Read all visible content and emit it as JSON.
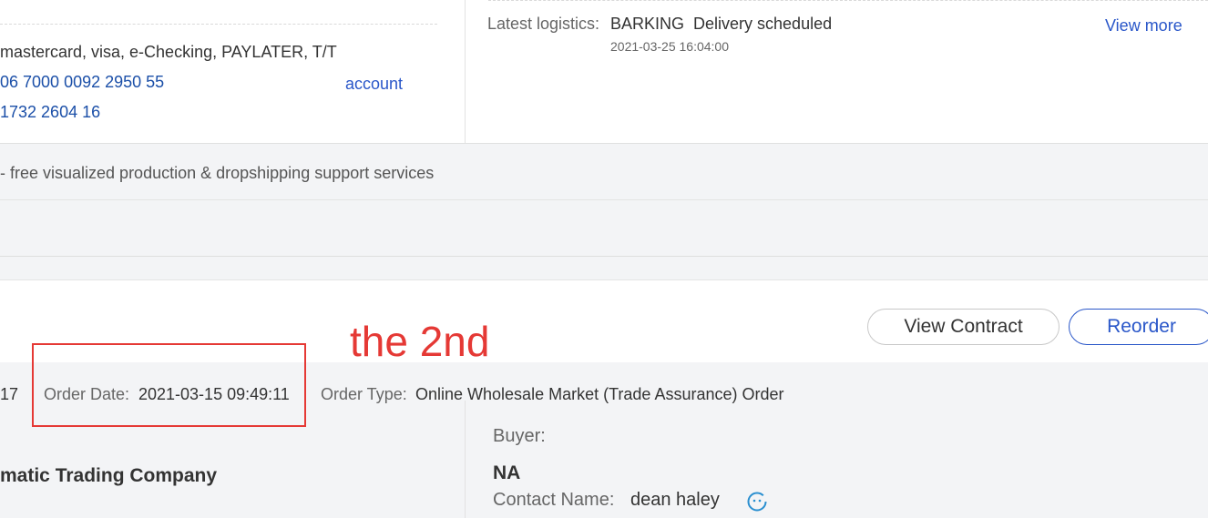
{
  "payment": {
    "methods": "mastercard, visa, e-Checking, PAYLATER, T/T",
    "account_number_1": "06 7000 0092 2950 55",
    "account_number_2": "1732 2604 16",
    "account_link": "account"
  },
  "logistics": {
    "label": "Latest logistics:",
    "status": "BARKING  Delivery scheduled",
    "timestamp": "2021-03-25 16:04:00",
    "view_more": "View more"
  },
  "promo": {
    "text": "- free visualized production & dropshipping support services"
  },
  "actions": {
    "view_contract": "View Contract",
    "reorder": "Reorder"
  },
  "annotation": {
    "text": "the 2nd",
    "color": "#e53935"
  },
  "order": {
    "id_fragment": "17",
    "date_label": "Order Date:",
    "date_value": "2021-03-15 09:49:11",
    "type_label": "Order Type:",
    "type_value": "Online Wholesale Market (Trade Assurance) Order",
    "supplier_name": "matic Trading Company",
    "buyer_label": "Buyer:",
    "buyer_name": "NA",
    "contact_label": "Contact Name:",
    "contact_name": "dean haley",
    "contact_icon": "chat-smiley-icon"
  },
  "colors": {
    "link_blue": "#2a57c9",
    "number_blue": "#1b4fa8",
    "band_gray": "#f3f4f6"
  }
}
